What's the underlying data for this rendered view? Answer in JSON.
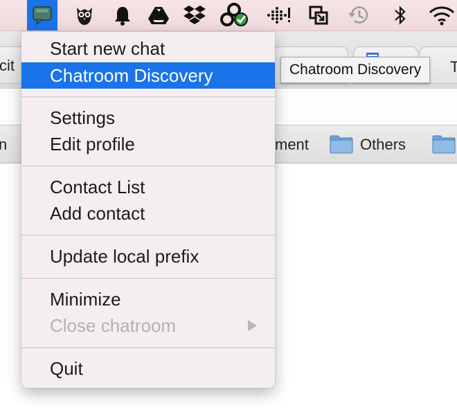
{
  "menubar": {
    "icons": [
      "chat-bubble-icon",
      "owl-icon",
      "bell-icon",
      "google-drive-icon",
      "dropbox-icon",
      "sync-check-icon",
      "fitbit-icon",
      "window-switch-icon",
      "time-machine-icon",
      "bluetooth-icon",
      "wifi-icon"
    ],
    "active_color": "#1a73e8"
  },
  "background": {
    "tab_left_text": "cit",
    "tab_right_text": "T",
    "bookmark_left_text": "n",
    "bookmark_fragment_text": "ment",
    "bookmark_others": "Others"
  },
  "tooltip": {
    "text": "Chatroom Discovery"
  },
  "menu": {
    "start_new_chat": "Start new chat",
    "chatroom_discovery": "Chatroom Discovery",
    "settings": "Settings",
    "edit_profile": "Edit profile",
    "contact_list": "Contact List",
    "add_contact": "Add contact",
    "update_local_prefix": "Update local prefix",
    "minimize": "Minimize",
    "close_chatroom": "Close chatroom",
    "quit": "Quit"
  },
  "colors": {
    "highlight": "#1a73e8",
    "menubar_bg": "#f3e0e3",
    "disabled_text": "#b2b2b2"
  }
}
